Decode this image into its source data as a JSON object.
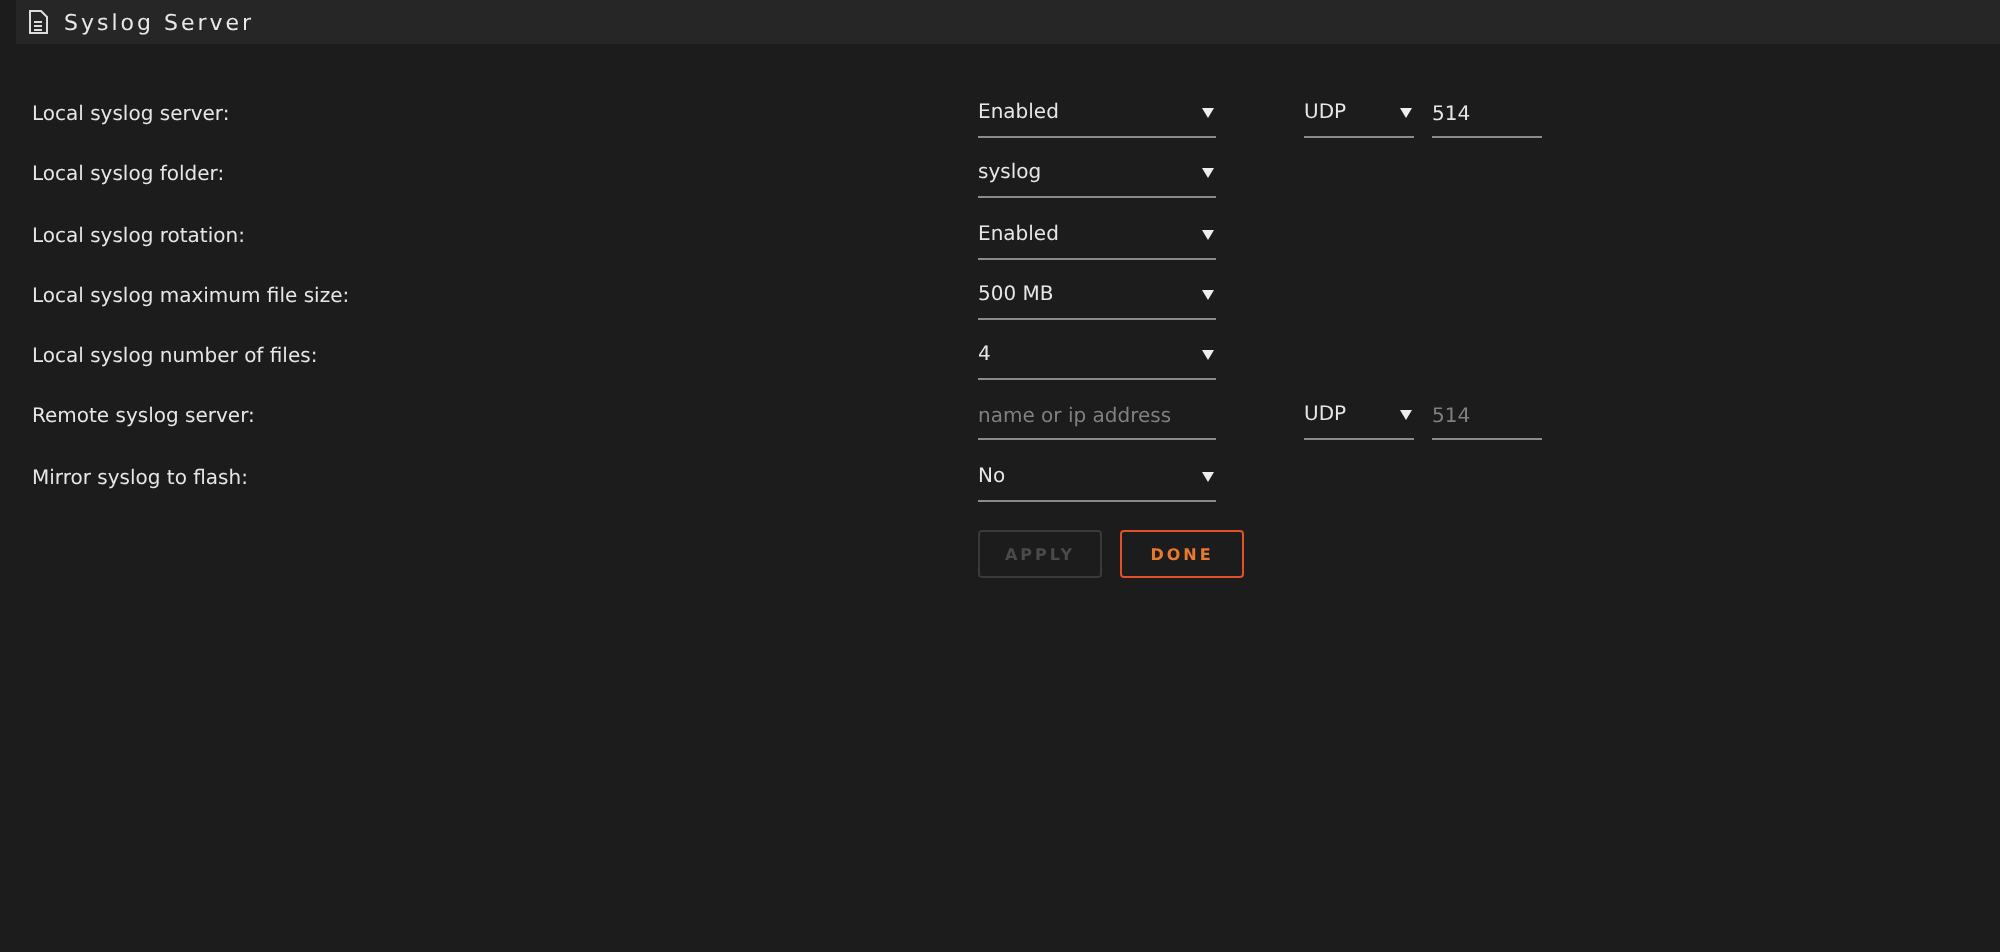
{
  "panel": {
    "title": "Syslog Server"
  },
  "rows": [
    {
      "label": "Local syslog server:",
      "field": {
        "kind": "select",
        "value": "Enabled"
      },
      "protocol": {
        "value": "UDP"
      },
      "port": {
        "value": "514"
      }
    },
    {
      "label": "Local syslog folder:",
      "field": {
        "kind": "select",
        "value": "syslog"
      }
    },
    {
      "label": "Local syslog rotation:",
      "field": {
        "kind": "select",
        "value": "Enabled"
      }
    },
    {
      "label": "Local syslog maximum file size:",
      "field": {
        "kind": "select",
        "value": "500 MB"
      }
    },
    {
      "label": "Local syslog number of files:",
      "field": {
        "kind": "select",
        "value": "4"
      }
    },
    {
      "label": "Remote syslog server:",
      "field": {
        "kind": "input",
        "placeholder": "name or ip address"
      },
      "protocol": {
        "value": "UDP"
      },
      "port": {
        "placeholder": "514"
      }
    },
    {
      "label": "Mirror syslog to flash:",
      "field": {
        "kind": "select",
        "value": "No"
      }
    }
  ],
  "buttons": [
    {
      "label": "APPLY",
      "disabled": true
    },
    {
      "label": "DONE",
      "disabled": false
    }
  ]
}
